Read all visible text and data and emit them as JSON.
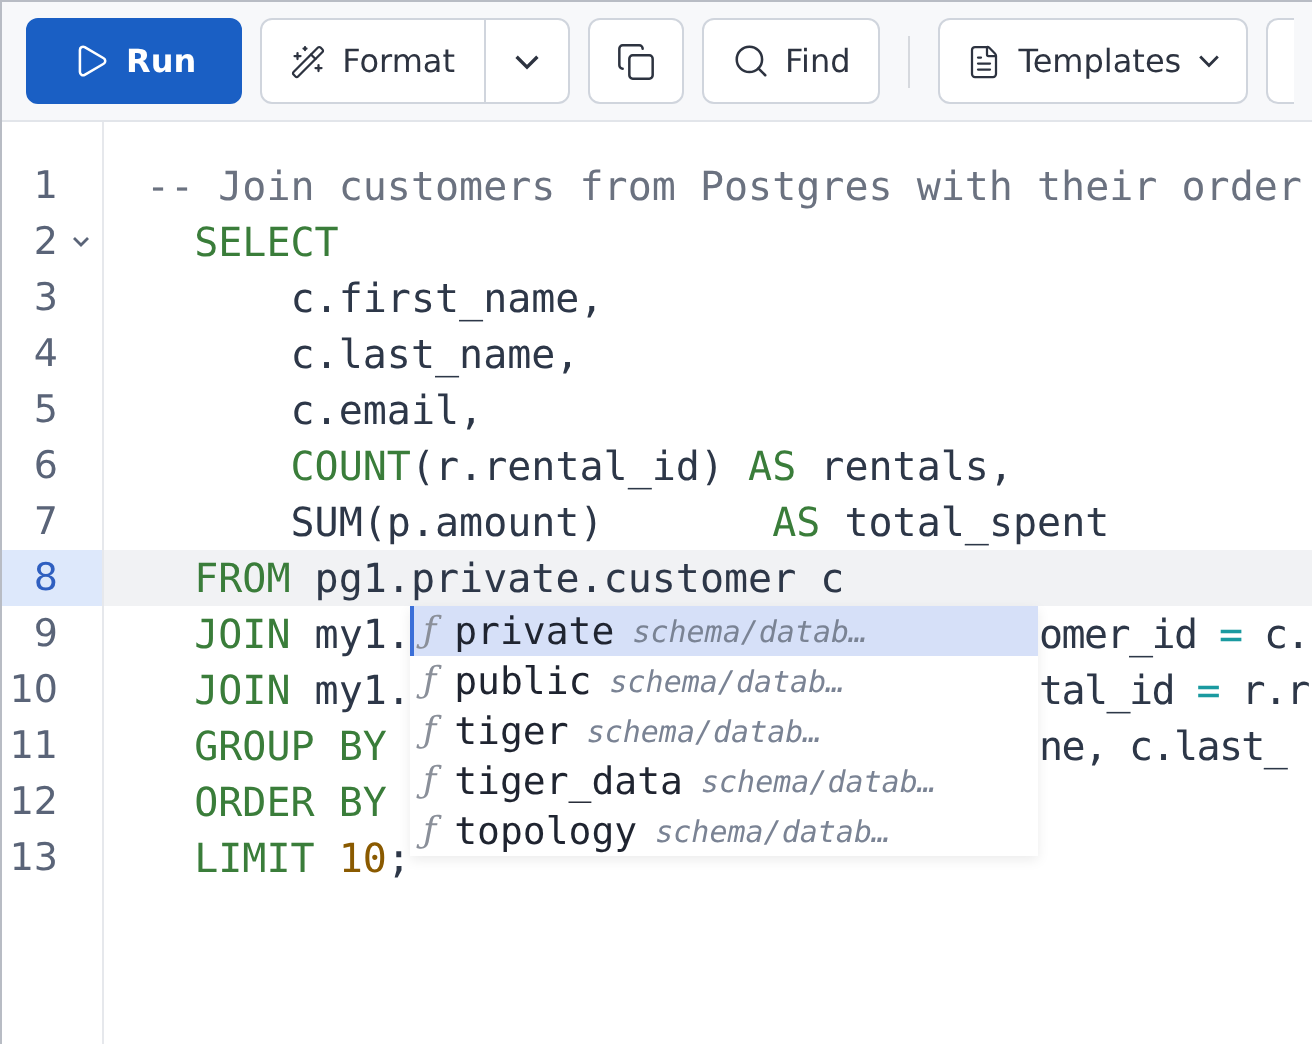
{
  "toolbar": [
    {
      "kind": "primary",
      "label": "Run"
    },
    {
      "kind": "split",
      "label": "Format"
    },
    {
      "kind": "icon"
    },
    {
      "kind": "button",
      "label": "Find"
    },
    {
      "kind": "divider"
    },
    {
      "kind": "menu",
      "label": "Templates"
    },
    {
      "kind": "stub"
    }
  ],
  "editor": {
    "lines": [
      {
        "number": "1",
        "kind": "top",
        "current": false,
        "foldable": false,
        "tokens": [
          {
            "kind": "comment",
            "text": "-- Join customers from Postgres with their order"
          }
        ]
      },
      {
        "number": "2",
        "kind": "clause",
        "current": false,
        "foldable": true,
        "tokens": [
          {
            "kind": "keyword",
            "text": "SELECT"
          }
        ]
      },
      {
        "number": "3",
        "kind": "item",
        "current": false,
        "foldable": false,
        "tokens": [
          {
            "kind": "plain",
            "text": "c.first_name,"
          }
        ]
      },
      {
        "number": "4",
        "kind": "item",
        "current": false,
        "foldable": false,
        "tokens": [
          {
            "kind": "plain",
            "text": "c.last_name,"
          }
        ]
      },
      {
        "number": "5",
        "kind": "item",
        "current": false,
        "foldable": false,
        "tokens": [
          {
            "kind": "plain",
            "text": "c.email,"
          }
        ]
      },
      {
        "number": "6",
        "kind": "item",
        "current": false,
        "foldable": false,
        "tokens": [
          {
            "kind": "keyword",
            "text": "COUNT"
          },
          {
            "kind": "plain",
            "text": "(r.rental_id) "
          },
          {
            "kind": "keyword",
            "text": "AS"
          },
          {
            "kind": "plain",
            "text": " rentals,"
          }
        ]
      },
      {
        "number": "7",
        "kind": "item",
        "current": false,
        "foldable": false,
        "tokens": [
          {
            "kind": "plain",
            "text": "SUM(p.amount)       "
          },
          {
            "kind": "keyword",
            "text": "AS"
          },
          {
            "kind": "plain",
            "text": " total_spent"
          }
        ]
      },
      {
        "number": "8",
        "kind": "clause",
        "current": true,
        "foldable": false,
        "tokens": [
          {
            "kind": "keyword",
            "text": "FROM"
          },
          {
            "kind": "plain",
            "text": " pg1.private.customer c"
          }
        ]
      },
      {
        "number": "9",
        "kind": "clause",
        "current": false,
        "foldable": false,
        "tokens": [
          {
            "kind": "keyword",
            "text": "JOIN"
          },
          {
            "kind": "plain",
            "text": " my1."
          }
        ],
        "tail": [
          {
            "kind": "plain",
            "text": "omer_id "
          },
          {
            "kind": "operator",
            "text": "="
          },
          {
            "kind": "plain",
            "text": " c."
          }
        ]
      },
      {
        "number": "10",
        "kind": "clause",
        "current": false,
        "foldable": false,
        "tokens": [
          {
            "kind": "keyword",
            "text": "JOIN"
          },
          {
            "kind": "plain",
            "text": " my1."
          }
        ],
        "tail": [
          {
            "kind": "plain",
            "text": "tal_id "
          },
          {
            "kind": "operator",
            "text": "="
          },
          {
            "kind": "plain",
            "text": " r.r"
          }
        ]
      },
      {
        "number": "11",
        "kind": "clause",
        "current": false,
        "foldable": false,
        "tokens": [
          {
            "kind": "keyword",
            "text": "GROUP BY"
          }
        ],
        "tail": [
          {
            "kind": "plain",
            "text": "ne, c.last_"
          }
        ]
      },
      {
        "number": "12",
        "kind": "clause",
        "current": false,
        "foldable": false,
        "tokens": [
          {
            "kind": "keyword",
            "text": "ORDER BY"
          }
        ]
      },
      {
        "number": "13",
        "kind": "clause",
        "current": false,
        "foldable": false,
        "tokens": [
          {
            "kind": "keyword",
            "text": "LIMIT "
          },
          {
            "kind": "number",
            "text": "10"
          },
          {
            "kind": "plain",
            "text": ";"
          }
        ]
      }
    ],
    "autocomplete": [
      {
        "glyph": "ƒ",
        "label": "private",
        "detail": "schema/datab…",
        "selected": true
      },
      {
        "glyph": "ƒ",
        "label": "public",
        "detail": "schema/datab…",
        "selected": false
      },
      {
        "glyph": "ƒ",
        "label": "tiger",
        "detail": "schema/datab…",
        "selected": false
      },
      {
        "glyph": "ƒ",
        "label": "tiger_data",
        "detail": "schema/datab…",
        "selected": false
      },
      {
        "glyph": "ƒ",
        "label": "topology",
        "detail": "schema/datab…",
        "selected": false
      }
    ]
  }
}
